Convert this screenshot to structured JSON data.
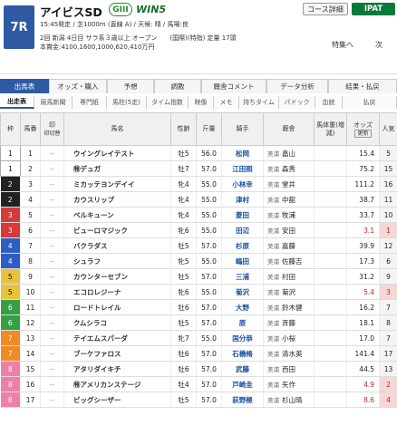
{
  "header": {
    "race_no": "7R",
    "race_name": "アイビスSD",
    "grade": "GIII",
    "win5": "WIN5",
    "course_button": "コース詳細",
    "ipat": "IPAT",
    "line1": "15:45発走 / 芝1000m (直線 A) / 天候: 晴 / 馬場:良",
    "line2": "2回 新潟 4日目 サラ系３歳以上 オープン　　(国際)(特指) 定量 17頭",
    "line3": "本賞金:4100,1600,1000,620,410万円",
    "feature_link": "特集へ",
    "next_label": "次"
  },
  "tabs_primary": [
    "出馬表",
    "オッズ・購入",
    "予想",
    "調教",
    "厩舎コメント",
    "データ分析",
    "結果・払戻"
  ],
  "tabs_secondary": [
    "出走表",
    "競馬新聞",
    "専門紙",
    "馬柱(5走)",
    "タイム指数",
    "映像",
    "メモ",
    "持ちタイム",
    "パドック",
    "血統",
    "払戻"
  ],
  "table_headers": {
    "waku": "枠",
    "umaban": "馬番",
    "mark": "印",
    "mark_sub": "印切替",
    "horse": "馬名",
    "sexage": "性齢",
    "weight": "斤量",
    "jockey": "騎手",
    "trainer": "厩舎",
    "body_weight": "馬体重(増減)",
    "odds": "オッズ",
    "odds_update": "更新",
    "popularity": "人気"
  },
  "rows": [
    {
      "waku": "1",
      "num": "1",
      "horse": "ウイングレイテスト",
      "sexage": "牡5",
      "weight": "56.0",
      "jockey": "松岡",
      "region": "美浦",
      "trainer": "畠山",
      "odds": "15.4",
      "pop": "5",
      "hot": false
    },
    {
      "waku": "1",
      "num": "2",
      "horse": "㊕デュガ",
      "sexage": "牡7",
      "weight": "57.0",
      "jockey": "江田照",
      "region": "美浦",
      "trainer": "森秀",
      "odds": "75.2",
      "pop": "15",
      "hot": false
    },
    {
      "waku": "2",
      "num": "3",
      "horse": "ミカッテヨンデイイ",
      "sexage": "牝4",
      "weight": "55.0",
      "jockey": "小林幸",
      "region": "美浦",
      "trainer": "堂井",
      "odds": "111.2",
      "pop": "16",
      "hot": false
    },
    {
      "waku": "2",
      "num": "4",
      "horse": "カウスリップ",
      "sexage": "牝4",
      "weight": "55.0",
      "jockey": "津村",
      "region": "美浦",
      "trainer": "中舘",
      "odds": "38.7",
      "pop": "11",
      "hot": false
    },
    {
      "waku": "3",
      "num": "5",
      "horse": "ベルキューン",
      "sexage": "牝4",
      "weight": "55.0",
      "jockey": "菱田",
      "region": "美浦",
      "trainer": "牧浦",
      "odds": "33.7",
      "pop": "10",
      "hot": false
    },
    {
      "waku": "3",
      "num": "6",
      "horse": "ビューロマジック",
      "sexage": "牝6",
      "weight": "55.0",
      "jockey": "田辺",
      "region": "美浦",
      "trainer": "安田",
      "odds": "3.1",
      "pop": "1",
      "hot": true
    },
    {
      "waku": "4",
      "num": "7",
      "horse": "バクラダス",
      "sexage": "牡5",
      "weight": "57.0",
      "jockey": "杉原",
      "region": "美浦",
      "trainer": "嘉藤",
      "odds": "39.9",
      "pop": "12",
      "hot": false
    },
    {
      "waku": "4",
      "num": "8",
      "horse": "シュラフ",
      "sexage": "牝5",
      "weight": "55.0",
      "jockey": "嶋田",
      "region": "美浦",
      "trainer": "佐藤吉",
      "odds": "17.3",
      "pop": "6",
      "hot": false
    },
    {
      "waku": "5",
      "num": "9",
      "horse": "カウンターセブン",
      "sexage": "牡5",
      "weight": "57.0",
      "jockey": "三浦",
      "region": "美浦",
      "trainer": "村田",
      "odds": "31.2",
      "pop": "9",
      "hot": false
    },
    {
      "waku": "5",
      "num": "10",
      "horse": "エコロレジーナ",
      "sexage": "牝6",
      "weight": "55.0",
      "jockey": "菊沢",
      "region": "美浦",
      "trainer": "菊沢",
      "odds": "5.4",
      "pop": "3",
      "hot": true
    },
    {
      "waku": "6",
      "num": "11",
      "horse": "ロードトレイル",
      "sexage": "牡6",
      "weight": "57.0",
      "jockey": "大野",
      "region": "美浦",
      "trainer": "鈴木健",
      "odds": "16.2",
      "pop": "7",
      "hot": false
    },
    {
      "waku": "6",
      "num": "12",
      "horse": "クムシラコ",
      "sexage": "牡5",
      "weight": "57.0",
      "jockey": "原",
      "region": "美浦",
      "trainer": "斉藤",
      "odds": "18.1",
      "pop": "8",
      "hot": false
    },
    {
      "waku": "7",
      "num": "13",
      "horse": "テイエムスパーダ",
      "sexage": "牝7",
      "weight": "55.0",
      "jockey": "国分恭",
      "region": "美浦",
      "trainer": "小桜",
      "odds": "17.0",
      "pop": "7",
      "hot": false
    },
    {
      "waku": "7",
      "num": "14",
      "horse": "ブーケファロス",
      "sexage": "牡6",
      "weight": "57.0",
      "jockey": "石橋脩",
      "region": "美浦",
      "trainer": "清水英",
      "odds": "141.4",
      "pop": "17",
      "hot": false
    },
    {
      "waku": "8",
      "num": "15",
      "horse": "アタリダイキチ",
      "sexage": "牡6",
      "weight": "57.0",
      "jockey": "武藤",
      "region": "美浦",
      "trainer": "西田",
      "odds": "44.5",
      "pop": "13",
      "hot": false
    },
    {
      "waku": "8",
      "num": "16",
      "horse": "㊕アメリカンステージ",
      "sexage": "牡4",
      "weight": "57.0",
      "jockey": "戸崎圭",
      "region": "美浦",
      "trainer": "矢作",
      "odds": "4.9",
      "pop": "2",
      "hot": true
    },
    {
      "waku": "8",
      "num": "17",
      "horse": "ビッグシーザー",
      "sexage": "牡5",
      "weight": "57.0",
      "jockey": "荻野極",
      "region": "美浦",
      "trainer": "杉山晴",
      "odds": "8.6",
      "pop": "4",
      "hot": true
    }
  ]
}
